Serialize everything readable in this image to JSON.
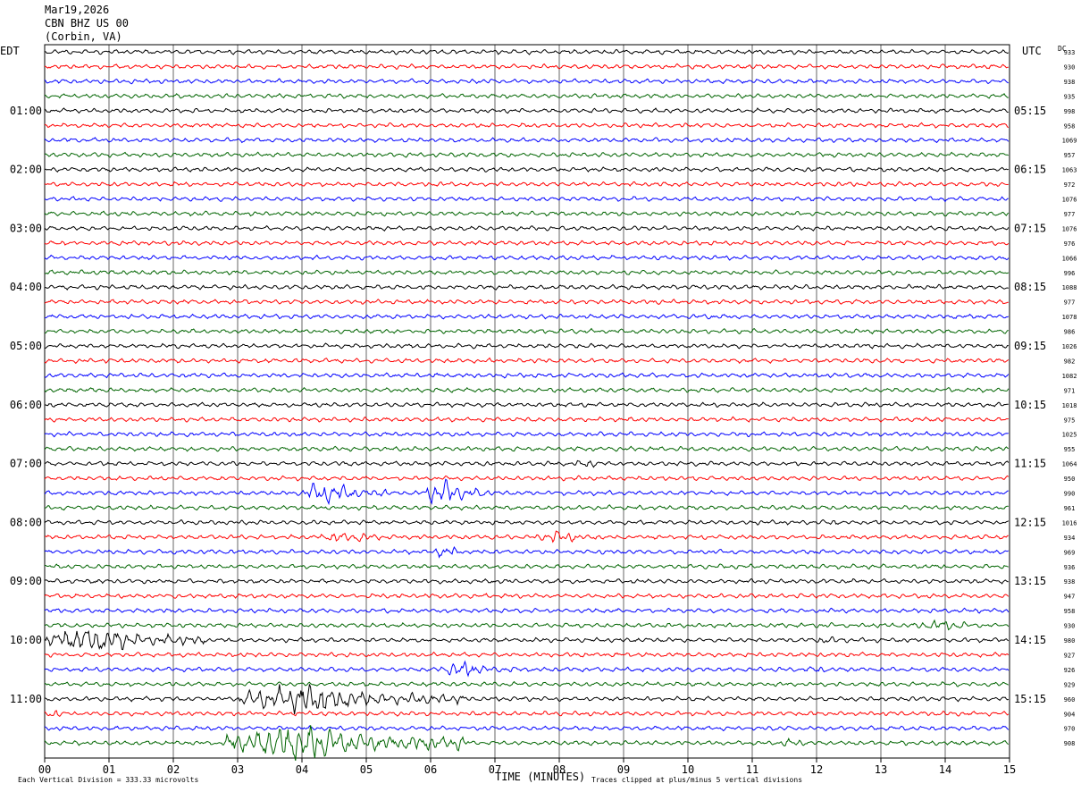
{
  "header": {
    "date": "Mar19,2026",
    "station": "CBN BHZ US 00",
    "location": "(Corbin, VA)"
  },
  "chart_data": {
    "type": "line",
    "title": "",
    "xlabel": "TIME (MINUTES)",
    "x_ticks": [
      "00",
      "01",
      "02",
      "03",
      "04",
      "05",
      "06",
      "07",
      "08",
      "09",
      "10",
      "11",
      "12",
      "13",
      "14",
      "15"
    ],
    "xlim": [
      0,
      15
    ],
    "left_timezone": "EDT",
    "right_timezone": "UTC",
    "dc_label": "DC",
    "left_hour_labels": [
      "01:00",
      "02:00",
      "03:00",
      "04:00",
      "05:00",
      "06:00",
      "07:00",
      "08:00",
      "09:00",
      "10:00",
      "11:00"
    ],
    "right_hour_labels": [
      "05:15",
      "06:15",
      "07:15",
      "08:15",
      "09:15",
      "10:15",
      "11:15",
      "12:15",
      "13:15",
      "14:15",
      "15:15"
    ],
    "trace_colors": [
      "#000000",
      "#ff0000",
      "#0000ff",
      "#006400"
    ],
    "dc_offsets": [
      933,
      930,
      938,
      935,
      998,
      958,
      1069,
      957,
      1063,
      972,
      1076,
      977,
      1076,
      976,
      1066,
      996,
      1088,
      977,
      1078,
      986,
      1026,
      982,
      1082,
      971,
      1018,
      975,
      1025,
      955,
      1064,
      950,
      990,
      961,
      1016,
      934,
      969,
      936,
      938,
      947,
      958,
      930,
      980,
      927,
      926,
      929,
      960,
      904,
      970,
      908
    ],
    "events": [
      {
        "trace": 0,
        "start": 6.1,
        "end": 6.6,
        "amp": 3
      },
      {
        "trace": 28,
        "start": 8.2,
        "end": 9.0,
        "amp": 5
      },
      {
        "trace": 30,
        "start": 4.0,
        "end": 5.3,
        "amp": 12
      },
      {
        "trace": 30,
        "start": 5.9,
        "end": 6.9,
        "amp": 14
      },
      {
        "trace": 32,
        "start": 12.0,
        "end": 12.6,
        "amp": 4
      },
      {
        "trace": 33,
        "start": 4.2,
        "end": 6.0,
        "amp": 6
      },
      {
        "trace": 33,
        "start": 7.6,
        "end": 8.8,
        "amp": 7
      },
      {
        "trace": 34,
        "start": 6.0,
        "end": 6.8,
        "amp": 6
      },
      {
        "trace": 39,
        "start": 13.5,
        "end": 15.0,
        "amp": 6
      },
      {
        "trace": 40,
        "start": 0.0,
        "end": 2.5,
        "amp": 14
      },
      {
        "trace": 40,
        "start": 11.9,
        "end": 12.8,
        "amp": 5
      },
      {
        "trace": 42,
        "start": 6.1,
        "end": 7.4,
        "amp": 9
      },
      {
        "trace": 42,
        "start": 11.8,
        "end": 12.5,
        "amp": 4
      },
      {
        "trace": 44,
        "start": 3.0,
        "end": 6.5,
        "amp": 16
      },
      {
        "trace": 45,
        "start": 0.0,
        "end": 0.6,
        "amp": 5
      },
      {
        "trace": 47,
        "start": 2.8,
        "end": 6.6,
        "amp": 20
      },
      {
        "trace": 47,
        "start": 11.4,
        "end": 12.2,
        "amp": 5
      }
    ],
    "footer_left": "Each Vertical Division =  333.33 microvolts",
    "footer_right": "Traces clipped at plus/minus 5 vertical divisions"
  }
}
